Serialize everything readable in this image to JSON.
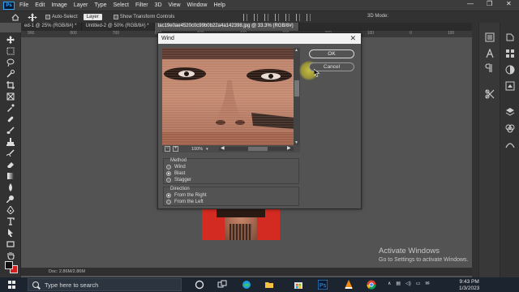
{
  "menubar": {
    "logo": "Ps",
    "items": [
      "File",
      "Edit",
      "Image",
      "Layer",
      "Type",
      "Select",
      "Filter",
      "3D",
      "View",
      "Window",
      "Help"
    ],
    "minimize": "—",
    "maximize": "❐",
    "close": "✕"
  },
  "optionsbar": {
    "auto_select_label": "Auto-Select:",
    "auto_select_value": "Layer",
    "transform_label": "Show Transform Controls",
    "mode_label": "3D Mode:"
  },
  "tabs": [
    {
      "label": "ed-1 @ 25% (RGB/8#) *"
    },
    {
      "label": "Untitled-2 @ 50% (RGB/8#) *"
    },
    {
      "label": "tac19e0ae4520c0c99b0b22a4a142398.jpg @ 33.3% (RGB/8#)"
    }
  ],
  "ruler": {
    "ticks": [
      "900",
      "800",
      "700",
      "600",
      "500",
      "400",
      "300",
      "200",
      "100",
      "0",
      "100",
      "150"
    ]
  },
  "dialog": {
    "title": "Wind",
    "close": "✕",
    "ok_label": "OK",
    "cancel_label": "Cancel",
    "zoom": "100%",
    "zoom_out": "−",
    "zoom_in": "+",
    "method": {
      "legend": "Method",
      "options": [
        {
          "label": "Wind",
          "selected": false
        },
        {
          "label": "Blast",
          "selected": true
        },
        {
          "label": "Stagger",
          "selected": false
        }
      ]
    },
    "direction": {
      "legend": "Direction",
      "options": [
        {
          "label": "From the Right",
          "selected": true
        },
        {
          "label": "From the Left",
          "selected": false
        }
      ]
    }
  },
  "statusbar": {
    "doc_info": "Doc: 2.86M/2.86M"
  },
  "watermark": {
    "title": "Activate Windows",
    "subtitle": "Go to Settings to activate Windows."
  },
  "taskbar": {
    "search_placeholder": "Type here to search",
    "time": "9:43 PM",
    "date": "1/3/2023"
  },
  "colors": {
    "foreground": "#111111",
    "background": "#d21e1e",
    "accent": "#31a8ff"
  }
}
